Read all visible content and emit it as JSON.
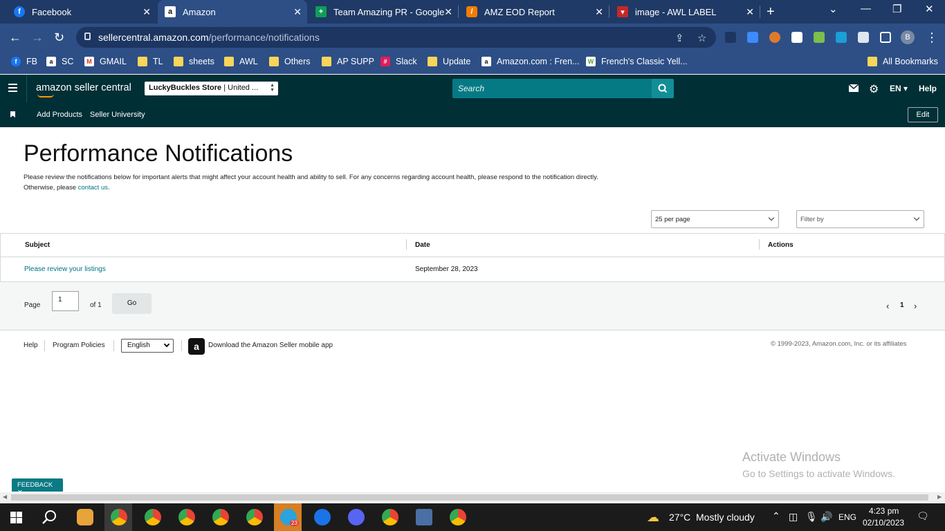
{
  "browser": {
    "tabs": [
      {
        "title": "Facebook",
        "icon": "facebook-icon"
      },
      {
        "title": "Amazon",
        "icon": "amazon-icon"
      },
      {
        "title": "Team Amazing PR - Google",
        "icon": "google-sheets-icon"
      },
      {
        "title": "AMZ EOD Report",
        "icon": "report-icon"
      },
      {
        "title": "image - AWL LABEL",
        "icon": "image-icon"
      }
    ],
    "url_host": "sellercentral.amazon.com",
    "url_path": "/performance/notifications",
    "bookmarks": [
      {
        "label": "FB",
        "icon": "facebook-icon"
      },
      {
        "label": "SC",
        "icon": "amazon-icon"
      },
      {
        "label": "GMAIL",
        "icon": "gmail-icon"
      },
      {
        "label": "TL",
        "icon": "folder-icon"
      },
      {
        "label": "sheets",
        "icon": "folder-icon"
      },
      {
        "label": "AWL",
        "icon": "folder-icon"
      },
      {
        "label": "Others",
        "icon": "folder-icon"
      },
      {
        "label": "AP SUPP",
        "icon": "folder-icon"
      },
      {
        "label": "Slack",
        "icon": "slack-icon"
      },
      {
        "label": "Update",
        "icon": "folder-icon"
      },
      {
        "label": "Amazon.com : Fren...",
        "icon": "amazon-icon"
      },
      {
        "label": "French's Classic Yell...",
        "icon": "site-icon"
      },
      {
        "label": "All Bookmarks",
        "icon": "folder-icon"
      }
    ],
    "profile_initial": "B"
  },
  "seller_header": {
    "logo_text": "amazon seller central",
    "store_name": "LuckyBuckles Store",
    "store_region": "| United ...",
    "search_placeholder": "Search",
    "language": "EN",
    "help_label": "Help",
    "subnav": [
      "Add Products",
      "Seller University"
    ],
    "edit_label": "Edit"
  },
  "main": {
    "title": "Performance Notifications",
    "intro_text": "Please review the notifications below for important alerts that might affect your account health and ability to sell. For any concerns regarding account health, please respond to the notification directly. Otherwise, please ",
    "intro_link": "contact us",
    "intro_end": ".",
    "per_page": "25 per page",
    "filter": "Filter by",
    "table": {
      "columns": [
        "Subject",
        "Date",
        "Actions"
      ],
      "rows": [
        {
          "subject": "Please review your listings",
          "date": "September 28, 2023",
          "actions": ""
        }
      ]
    },
    "pager": {
      "page_label": "Page",
      "page_value": "1",
      "of_label": "of 1",
      "go_label": "Go",
      "current_page": "1"
    }
  },
  "footer": {
    "help": "Help",
    "policies": "Program Policies",
    "language": "English",
    "app_text": "Download the Amazon Seller mobile app",
    "copyright": "© 1999-2023, Amazon.com, Inc. or its affiliates"
  },
  "overlay": {
    "activate_title": "Activate Windows",
    "activate_sub": "Go to Settings to activate Windows.",
    "feedback_label": "FEEDBACK"
  },
  "taskbar": {
    "weather_temp": "27°C",
    "weather_desc": "Mostly cloudy",
    "lang": "ENG",
    "time": "4:23 pm",
    "date": "02/10/2023",
    "telegram_badge": "23"
  },
  "colors": {
    "header_bg": "#002f36",
    "link": "#007185",
    "browser_bg": "#2d4f86",
    "search_bg": "#067a84"
  }
}
